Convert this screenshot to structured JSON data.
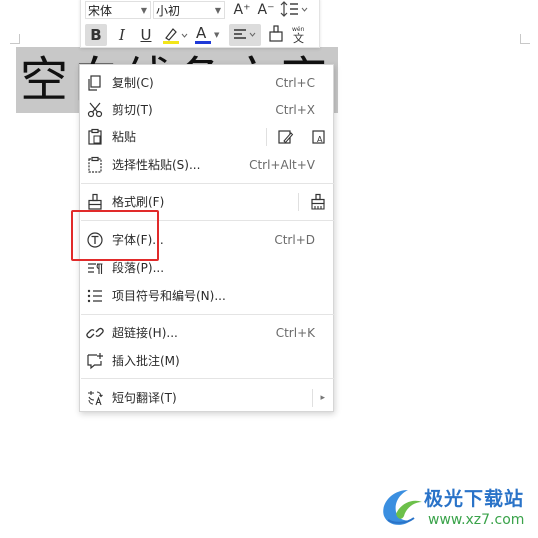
{
  "toolbar": {
    "font_name": "宋体",
    "font_size": "小初",
    "grow_font_icon": "A⁺",
    "shrink_font_icon": "A⁻",
    "bold_label": "B",
    "italic_label": "I",
    "underline_label": "U",
    "font_color_label": "A"
  },
  "document": {
    "selected_text": "空白线条文字"
  },
  "menu": {
    "items": [
      {
        "label": "复制(C)",
        "shortcut": "Ctrl+C",
        "icon": "copy-icon"
      },
      {
        "label": "剪切(T)",
        "shortcut": "Ctrl+X",
        "icon": "scissors-icon"
      },
      {
        "label": "粘贴",
        "shortcut": "",
        "icon": "paste-icon"
      },
      {
        "label": "选择性粘贴(S)...",
        "shortcut": "Ctrl+Alt+V",
        "icon": "paste-special-icon"
      },
      {
        "label": "格式刷(F)",
        "shortcut": "",
        "icon": "format-painter-icon"
      },
      {
        "label": "字体(F)...",
        "shortcut": "Ctrl+D",
        "icon": "font-icon"
      },
      {
        "label": "段落(P)...",
        "shortcut": "",
        "icon": "paragraph-icon"
      },
      {
        "label": "项目符号和编号(N)...",
        "shortcut": "",
        "icon": "bullet-list-icon"
      },
      {
        "label": "超链接(H)...",
        "shortcut": "Ctrl+K",
        "icon": "hyperlink-icon"
      },
      {
        "label": "插入批注(M)",
        "shortcut": "",
        "icon": "comment-icon"
      },
      {
        "label": "短句翻译(T)",
        "shortcut": "",
        "icon": "translate-icon"
      }
    ]
  },
  "watermark": {
    "title": "极光下载站",
    "url": "www.xz7.com"
  },
  "colors": {
    "highlight_box": "#e12a2a",
    "selection": "#c8c8c8",
    "watermark_blue": "#2a73c8",
    "watermark_green": "#3aa34a"
  }
}
